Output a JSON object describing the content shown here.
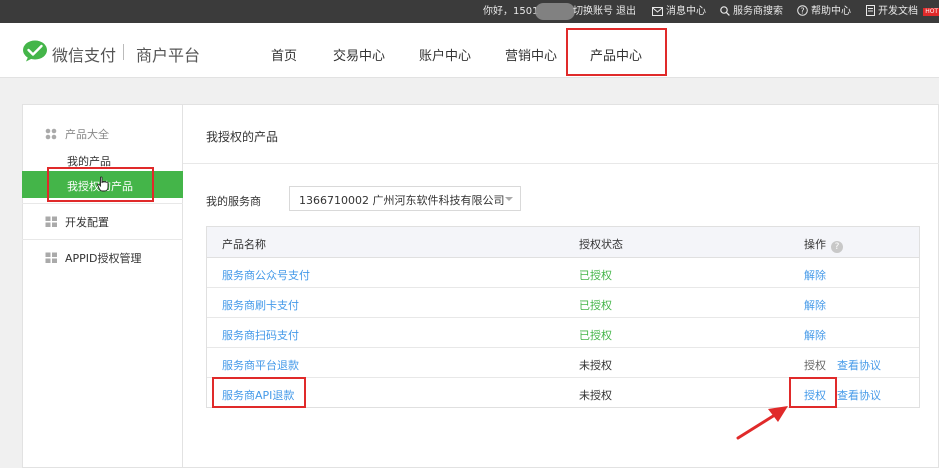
{
  "topbar": {
    "greeting": "你好，1501",
    "switch_account": "切换账号",
    "logout": "退出",
    "messages": "消息中心",
    "provider_search": "服务商搜索",
    "help": "帮助中心",
    "dev_docs": "开发文档",
    "hot_badge": "HOT"
  },
  "header": {
    "brand": "微信支付",
    "platform": "商户平台",
    "nav": [
      "首页",
      "交易中心",
      "账户中心",
      "营销中心",
      "产品中心"
    ]
  },
  "sidebar": {
    "group1": "产品大全",
    "items": [
      "我的产品",
      "我授权的产品"
    ],
    "group2": "开发配置",
    "group3": "APPID授权管理"
  },
  "main": {
    "title": "我授权的产品",
    "provider_label": "我的服务商",
    "provider_value": "1366710002 广州河东软件科技有限公司"
  },
  "table": {
    "headers": [
      "产品名称",
      "授权状态",
      "操作"
    ],
    "rows": [
      {
        "name": "服务商公众号支付",
        "status": "已授权",
        "action": "解除",
        "extra": ""
      },
      {
        "name": "服务商刷卡支付",
        "status": "已授权",
        "action": "解除",
        "extra": ""
      },
      {
        "name": "服务商扫码支付",
        "status": "已授权",
        "action": "解除",
        "extra": ""
      },
      {
        "name": "服务商平台退款",
        "status": "未授权",
        "action": "授权",
        "extra": "查看协议"
      },
      {
        "name": "服务商API退款",
        "status": "未授权",
        "action": "授权",
        "extra": "查看协议"
      }
    ]
  },
  "colors": {
    "accent_green": "#44b549",
    "link_blue": "#459ae9",
    "highlight_red": "#e02a2a",
    "topbar_bg": "#3b3b3b"
  }
}
